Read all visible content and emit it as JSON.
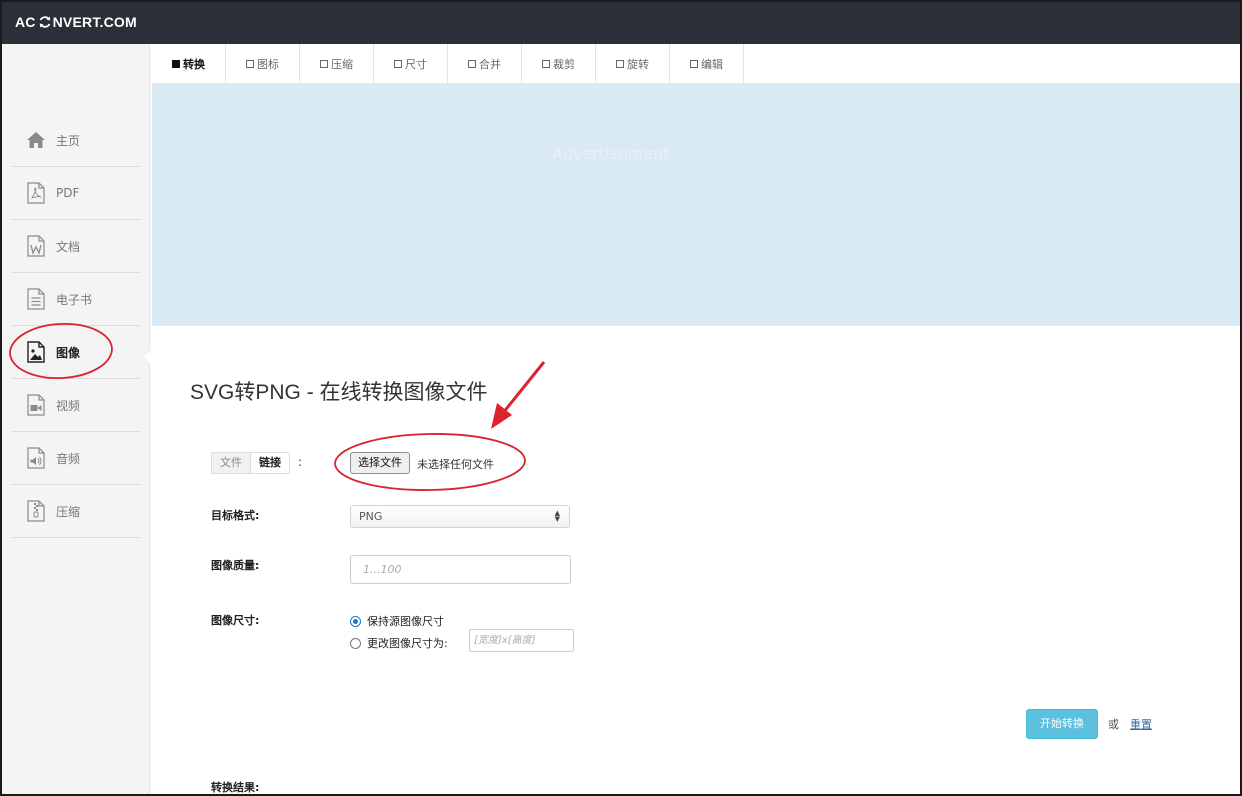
{
  "header": {
    "logo_left": "AC",
    "logo_right": "NVERT.COM",
    "logo_icon": "refresh-icon",
    "bg_color": "#2b2f38"
  },
  "sidebar": {
    "items": [
      {
        "label": "主页",
        "icon": "home-icon"
      },
      {
        "label": "PDF",
        "icon": "pdf-file-icon"
      },
      {
        "label": "文档",
        "icon": "word-file-icon"
      },
      {
        "label": "电子书",
        "icon": "ebook-file-icon"
      },
      {
        "label": "图像",
        "icon": "image-file-icon",
        "active": true
      },
      {
        "label": "视频",
        "icon": "video-file-icon"
      },
      {
        "label": "音频",
        "icon": "audio-file-icon"
      },
      {
        "label": "压缩",
        "icon": "archive-file-icon"
      }
    ]
  },
  "tabs": [
    {
      "label": "转换",
      "active": true
    },
    {
      "label": "图标"
    },
    {
      "label": "压缩"
    },
    {
      "label": "尺寸"
    },
    {
      "label": "合并"
    },
    {
      "label": "裁剪"
    },
    {
      "label": "旋转"
    },
    {
      "label": "编辑"
    }
  ],
  "banner": {
    "text": "Advertisement",
    "bg_color": "#d9eaf5"
  },
  "main": {
    "title": "SVG转PNG - 在线转换图像文件",
    "source": {
      "file_tab": "文件",
      "link_tab": "链接",
      "colon": ":",
      "choose_button": "选择文件",
      "no_file_text": "未选择任何文件"
    },
    "target_format": {
      "label": "目标格式:",
      "value": "PNG"
    },
    "quality": {
      "label": "图像质量:",
      "placeholder": "1...100"
    },
    "size": {
      "label": "图像尺寸:",
      "keep_option": "保持源图像尺寸",
      "change_option": "更改图像尺寸为:",
      "change_placeholder": "[宽度]x[高度]",
      "selected": "keep"
    },
    "convert_button": "开始转换",
    "or_text": "或",
    "reset_link": "重置",
    "result_label": "转换结果:"
  },
  "colors": {
    "accent": "#5bc0de",
    "annotation": "#d9232d",
    "radio_selected": "#1e74d2"
  }
}
